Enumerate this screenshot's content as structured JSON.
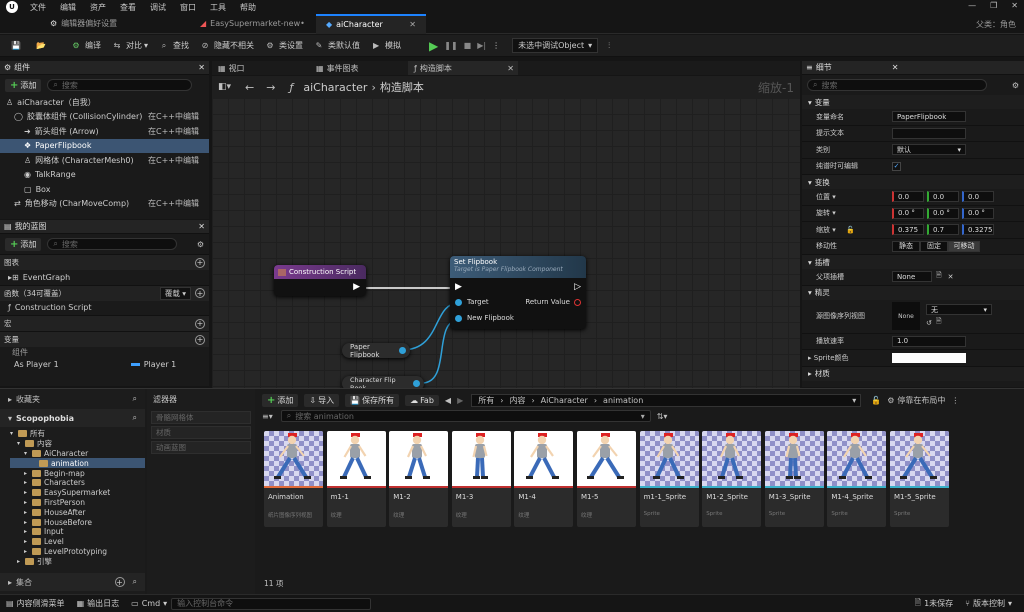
{
  "menu": [
    "文件",
    "编辑",
    "资产",
    "查看",
    "调试",
    "窗口",
    "工具",
    "帮助"
  ],
  "tabs": [
    "编辑器偏好设置",
    "EasySupermarket-new•",
    "aiCharacter"
  ],
  "parent_label": "父类：角色",
  "toolbar": {
    "compile": "编译",
    "diff": "对比",
    "find": "查找",
    "hide": "隐藏不相关",
    "class_settings": "类设置",
    "class_defaults": "类默认值",
    "simulate": "模拟",
    "debug_object": "未选中调试Object"
  },
  "components": {
    "title": "组件",
    "add": "添加",
    "search_placeholder": "搜索",
    "items": [
      {
        "label": "aiCharacter（自我）",
        "right": ""
      },
      {
        "label": "胶囊体组件 (CollisionCylinder)",
        "right": "在C++中编辑"
      },
      {
        "label": "箭头组件 (Arrow)",
        "right": "在C++中编辑"
      },
      {
        "label": "PaperFlipbook",
        "right": ""
      },
      {
        "label": "网格体 (CharacterMesh0)",
        "right": "在C++中编辑"
      },
      {
        "label": "TalkRange",
        "right": ""
      },
      {
        "label": "Box",
        "right": ""
      },
      {
        "label": "角色移动 (CharMoveComp)",
        "right": "在C++中编辑"
      }
    ]
  },
  "mybp": {
    "title": "我的蓝图",
    "add": "添加",
    "search_placeholder": "搜索",
    "graphs": "图表",
    "event_graph": "EventGraph",
    "functions": "函数（34可覆盖）",
    "override": "覆载",
    "construction": "Construction Script",
    "macros": "宏",
    "variables": "变量",
    "components": "组件",
    "var_name": "As Player 1",
    "var_type": "Player 1"
  },
  "graph_tabs": [
    "视口",
    "事件图表",
    "构造脚本"
  ],
  "breadcrumb": {
    "root": "aiCharacter",
    "leaf": "构造脚本",
    "zoom": "缩放-1"
  },
  "nodes": {
    "construction": "Construction Script",
    "set_title": "Set Flipbook",
    "set_sub": "Target is Paper Flipbook Component",
    "target": "Target",
    "new_flipbook": "New Flipbook",
    "return_value": "Return Value",
    "paper_flipbook": "Paper Flipbook",
    "char_flip": "Character Flip Book"
  },
  "details": {
    "title": "细节",
    "search_placeholder": "搜索",
    "variable_section": "变量",
    "var_name_label": "变量命名",
    "var_name": "PaperFlipbook",
    "tooltip": "提示文本",
    "category_label": "类别",
    "category": "默认",
    "editable": "纯谱时可编辑",
    "transform": "变换",
    "loc": "位置",
    "rot": "旋转",
    "scale": "缩放",
    "loc_v": [
      "0.0",
      "0.0",
      "0.0"
    ],
    "rot_v": [
      "0.0 °",
      "0.0 °",
      "0.0 °"
    ],
    "scale_v": [
      "0.375",
      "0.7",
      "0.3275"
    ],
    "mobility": "移动性",
    "mob_opts": [
      "静态",
      "固定",
      "可移动"
    ],
    "sockets": "插槽",
    "parent_socket": "父项插槽",
    "none": "None",
    "sprite": "精灵",
    "source_flipbook": "源图像序列视图",
    "none2": "None",
    "none3": "无",
    "play_rate": "播放速率",
    "play_rate_v": "1.0",
    "sprite_color": "Sprite颜色",
    "material": "材质"
  },
  "browser": {
    "favorites": "收藏夹",
    "project": "Scopophobia",
    "filters": "滤器器",
    "filter_items": [
      "骨骼网格体",
      "材质",
      "动画蓝图"
    ],
    "add": "添加",
    "import": "导入",
    "save_all": "保存所有",
    "fab": "Fab",
    "path": [
      "所有",
      "内容",
      "AiCharacter",
      "animation"
    ],
    "search_placeholder": "搜索 animation",
    "dock": "停靠在布局中",
    "count": "11 项",
    "collections": "集合",
    "tree": [
      {
        "label": "所有",
        "level": 0
      },
      {
        "label": "内容",
        "level": 1
      },
      {
        "label": "AiCharacter",
        "level": 2
      },
      {
        "label": "animation",
        "level": 3
      },
      {
        "label": "Begin-map",
        "level": 2
      },
      {
        "label": "Characters",
        "level": 2
      },
      {
        "label": "EasySupermarket",
        "level": 2
      },
      {
        "label": "FirstPerson",
        "level": 2
      },
      {
        "label": "HouseAfter",
        "level": 2
      },
      {
        "label": "HouseBefore",
        "level": 2
      },
      {
        "label": "Input",
        "level": 2
      },
      {
        "label": "Level",
        "level": 2
      },
      {
        "label": "LevelPrototyping",
        "level": 2
      },
      {
        "label": "引擎",
        "level": 1
      }
    ],
    "assets": [
      {
        "name": "Animation",
        "type": "纸片图像序列视图",
        "bg": "checker",
        "bar": "#e06a3a"
      },
      {
        "name": "m1-1",
        "type": "纹理",
        "bg": "white",
        "bar": "#c03030"
      },
      {
        "name": "M1-2",
        "type": "纹理",
        "bg": "white",
        "bar": "#c03030"
      },
      {
        "name": "M1-3",
        "type": "纹理",
        "bg": "white",
        "bar": "#c03030"
      },
      {
        "name": "M1-4",
        "type": "纹理",
        "bg": "white",
        "bar": "#c03030"
      },
      {
        "name": "M1-5",
        "type": "纹理",
        "bg": "white",
        "bar": "#c03030"
      },
      {
        "name": "m1-1_Sprite",
        "type": "Sprite",
        "bg": "checker",
        "bar": "#3ab0c8"
      },
      {
        "name": "M1-2_Sprite",
        "type": "Sprite",
        "bg": "checker",
        "bar": "#3ab0c8"
      },
      {
        "name": "M1-3_Sprite",
        "type": "Sprite",
        "bg": "checker",
        "bar": "#3ab0c8"
      },
      {
        "name": "M1-4_Sprite",
        "type": "Sprite",
        "bg": "checker",
        "bar": "#3ab0c8"
      },
      {
        "name": "M1-5_Sprite",
        "type": "Sprite",
        "bg": "checker",
        "bar": "#3ab0c8"
      }
    ]
  },
  "status": {
    "drawer": "内容侧滑菜单",
    "log": "输出日志",
    "cmd": "Cmd",
    "console_placeholder": "输入控制台命令",
    "unsaved": "1未保存",
    "source": "版本控制"
  }
}
